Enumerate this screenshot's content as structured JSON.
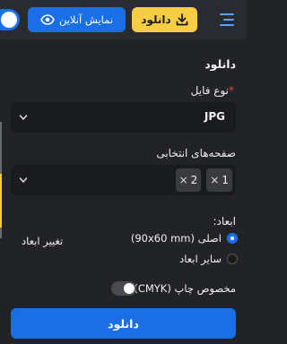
{
  "topbar": {
    "download_label": "دانلود",
    "online_label": "نمایش آنلاین"
  },
  "panel": {
    "title": "دانلود",
    "filetype_label": "نوع فایل",
    "required_mark": "*",
    "filetype_value": "JPG",
    "pages_label": "صفحه‌های انتخابی",
    "pages": [
      "1",
      "2"
    ],
    "chip_remove": "×",
    "dimensions_label": "ابعاد:",
    "option_original": "اصلی (90x60 mm)",
    "option_other": "سایر ابعاد",
    "resize_label": "تغییر ابعاد",
    "print_label": "مخصوص چاپ (CMYK)",
    "print_enabled": false,
    "download_button": "دانلود"
  },
  "colors": {
    "accent_blue": "#1b6fe6",
    "accent_yellow": "#f6cd45",
    "required_red": "#e0463f"
  }
}
